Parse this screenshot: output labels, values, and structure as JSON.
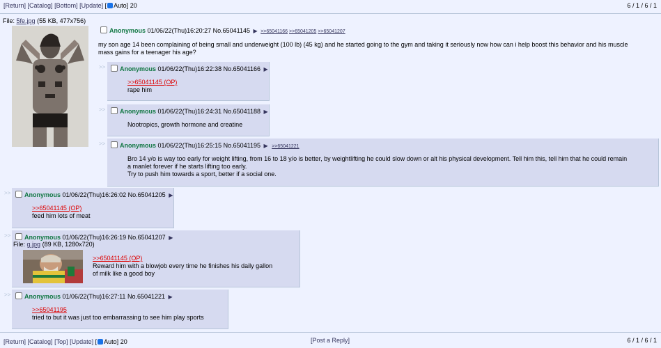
{
  "nav_top": {
    "return": "[Return]",
    "catalog": "[Catalog]",
    "bottom": "[Bottom]",
    "update": "[Update]",
    "bracket_open": "[",
    "auto": "Auto]",
    "count": "20"
  },
  "nav_bottom": {
    "overlap": "[Return] [Catalog]",
    "top": "[Top]",
    "update": "[Update]",
    "bracket_open": "[",
    "auto": "Auto]",
    "count": "20",
    "post_reply": "[Post a Reply]"
  },
  "pager": "6 / 1 / 6 / 1",
  "arrow": ">>",
  "op": {
    "file_label": "File:",
    "file_name": "5fe.jpg",
    "file_info": "(55 KB, 477x756)",
    "name": "Anonymous",
    "datetime": "01/06/22(Thu)16:20:27",
    "no": "No.65041145",
    "backlinks": [
      ">>65041166",
      ">>65041205",
      ">>65041207"
    ],
    "message": "my son age 14 been complaining of being small and underweight (100 lb) (45 kg) and he started going to the gym and taking it seriously now how can i help boost this behavior and his muscle mass gains for a teenager his age?"
  },
  "replies": [
    {
      "name": "Anonymous",
      "datetime": "01/06/22(Thu)16:22:38",
      "no": "No.65041166",
      "quote": ">>65041145 (OP)",
      "text": "rape him"
    },
    {
      "name": "Anonymous",
      "datetime": "01/06/22(Thu)16:24:31",
      "no": "No.65041188",
      "text": "Nootropics, growth hormone and creatine"
    },
    {
      "name": "Anonymous",
      "datetime": "01/06/22(Thu)16:25:15",
      "no": "No.65041195",
      "backlink": ">>65041221",
      "lines": [
        "Bro 14 y/o is way too early for weight lifting, from 16 to 18 y/o is better, by weightlifting he could slow down or alt his physical development. Tell him this, tell him that he could remain",
        "a manlet forever if he starts lifting too early.",
        "Try to push him towards a sport, better if a social one."
      ]
    },
    {
      "name": "Anonymous",
      "datetime": "01/06/22(Thu)16:26:02",
      "no": "No.65041205",
      "quote": ">>65041145 (OP)",
      "text": "feed him lots of meat"
    },
    {
      "name": "Anonymous",
      "datetime": "01/06/22(Thu)16:26:19",
      "no": "No.65041207",
      "file_label": "File:",
      "file_name": "g.jpg",
      "file_info": "(89 KB, 1280x720)",
      "quote": ">>65041145 (OP)",
      "lines": [
        "Reward him with a blowjob every time he finishes his daily gallon",
        "of milk like a good boy"
      ]
    },
    {
      "name": "Anonymous",
      "datetime": "01/06/22(Thu)16:27:11",
      "no": "No.65041221",
      "quote": ">>65041195",
      "text": "tried to but it was just too embarrassing to see him play sports"
    }
  ],
  "icons": {
    "checkbox": "checkbox-icon",
    "arrow": "menu-triangle-icon"
  },
  "colors": {
    "background": "#eef2ff",
    "reply_bg": "#d6daf0",
    "name": "#117743",
    "quote": "#dd0000",
    "link": "#34345c"
  }
}
